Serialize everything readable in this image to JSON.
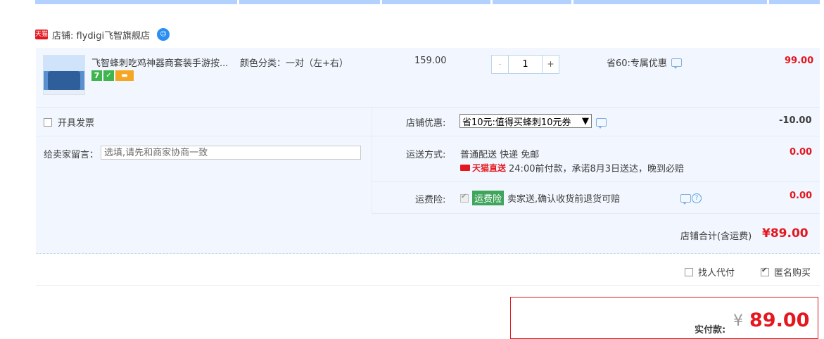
{
  "shop": {
    "badge": "天猫",
    "name": "店铺: flydigi飞智旗舰店"
  },
  "item": {
    "title": "飞智蜂刺吃鸡神器商套装手游按...",
    "sku": "颜色分类：一对（左+右）",
    "badges": {
      "seven": "7",
      "shield": "✓",
      "card": "▬"
    },
    "price": "159.00",
    "quantity": "1",
    "minus": "-",
    "plus": "+",
    "promotion": "省60:专属优惠",
    "subtotal": "99.00"
  },
  "options": {
    "invoice_label": "开具发票",
    "memo_label": "给卖家留言：",
    "memo_placeholder": "选填,请先和商家协商一致",
    "shop_discount_label": "店铺优惠:",
    "shop_discount_selected": "省10元:值得买蜂刺10元券",
    "shop_discount_arrow": "▼",
    "shop_discount_amount": "-10.00",
    "shipping_label": "运送方式:",
    "shipping_method": "普通配送 快递 免邮",
    "tmall_direct": "天猫直送",
    "shipping_promise": "24:00前付款，承诺8月3日送达，晚到必赔",
    "shipping_amount": "0.00",
    "insurance_label": "运费险:",
    "insurance_tag": "运费险",
    "insurance_text": "卖家送,确认收货前退货可赔",
    "insurance_amount": "0.00",
    "help": "?"
  },
  "totals": {
    "shop_total_label": "店铺合计(含运费)",
    "shop_total_amount": "¥89.00",
    "proxy_label": "找人代付",
    "anonymous_label": "匿名购买",
    "pay_label": "实付款:",
    "pay_currency": "¥",
    "pay_amount": "89.00"
  },
  "colors": {
    "accent_red": "#e4161e",
    "row_bg": "#f2f7ff",
    "header_line": "#b2d1ff",
    "insurance_green": "#3fa45c"
  }
}
